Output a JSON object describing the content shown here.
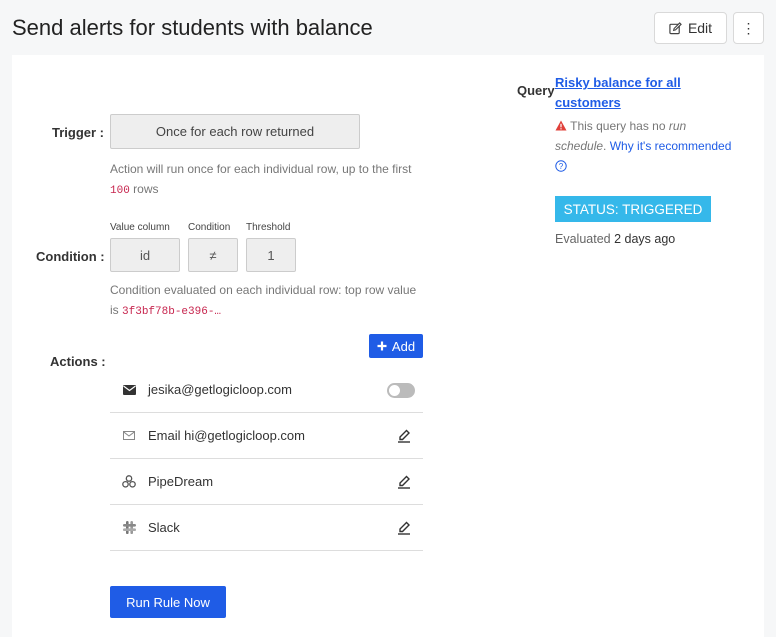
{
  "header": {
    "title": "Send alerts for students with balance",
    "edit_label": "Edit",
    "more_glyph": "⋮"
  },
  "trigger": {
    "label": "Trigger :",
    "value": "Once for each row returned",
    "help_prefix": "Action will run once for each individual row, up to the first",
    "help_limit": "100",
    "help_suffix": "rows"
  },
  "condition": {
    "label": "Condition :",
    "value_column_header": "Value column",
    "condition_header": "Condition",
    "threshold_header": "Threshold",
    "value_column": "id",
    "operator": "≠",
    "threshold": "1",
    "help_prefix": "Condition evaluated on each individual row: top row value is",
    "help_value": "3f3bf78b-e396-…"
  },
  "actions": {
    "label": "Actions :",
    "add_label": "Add",
    "items": [
      {
        "label": "jesika@getlogicloop.com",
        "icon": "envelope-solid-icon",
        "control": "toggle"
      },
      {
        "label": "Email hi@getlogicloop.com",
        "icon": "envelope-outline-icon",
        "control": "edit"
      },
      {
        "label": "PipeDream",
        "icon": "pipedream-icon",
        "control": "edit"
      },
      {
        "label": "Slack",
        "icon": "slack-icon",
        "control": "edit"
      }
    ],
    "toggle_on": false
  },
  "run_label": "Run Rule Now",
  "query": {
    "label": "Query",
    "link": "Risky balance for all customers",
    "warning_text": "This query has no",
    "warning_em": "run schedule",
    "why_text": "Why it's recommended",
    "status": "STATUS: TRIGGERED",
    "evaluated_prefix": "Evaluated",
    "evaluated_value": "2 days ago"
  },
  "colors": {
    "primary": "#1f5ce6",
    "status": "#35b8ea",
    "warning": "#e0403a",
    "mono": "#c7254e"
  }
}
